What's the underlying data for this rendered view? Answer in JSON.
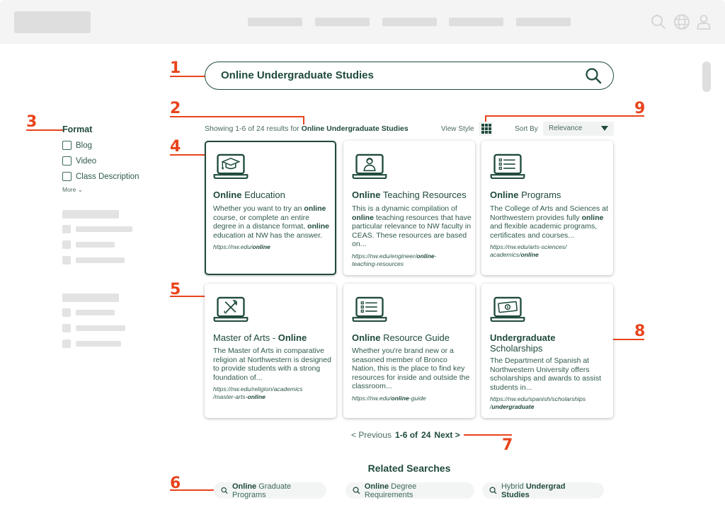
{
  "header": {
    "nav_placeholders": 5,
    "icons": [
      "search-icon",
      "globe-icon",
      "user-icon"
    ]
  },
  "search": {
    "query": "Online Undergraduate Studies",
    "icon": "search-icon"
  },
  "results": {
    "summary_prefix": "Showing 1-6 of 24 results for ",
    "summary_query": "Online Undergraduate Studies",
    "view_style_label": "View Style",
    "view_style_icon": "grid-icon",
    "sort_label": "Sort By",
    "sort_value": "Relevance"
  },
  "filters": {
    "title": "Format",
    "options": [
      {
        "label": "Blog",
        "checked": false
      },
      {
        "label": "Video",
        "checked": false
      },
      {
        "label": "Class Description",
        "checked": false
      }
    ],
    "more_label": "More"
  },
  "cards": [
    {
      "icon": "graduation-cap-laptop-icon",
      "title_bold": "Online",
      "title_rest": " Education",
      "body_html": "Whether you want to try an <b>online</b> course, or complete an entire degree in a distance format, <b>online</b> education at NW has the answer.",
      "url_html": "https://nw.edu/<b>online</b>",
      "selected": true
    },
    {
      "icon": "teacher-laptop-icon",
      "title_bold": "Online",
      "title_rest": " Teaching Resources",
      "body_html": "This is a dynamic compilation of <b>online</b> teaching resources that have particular relevance to NW faculty in CEAS. These resources are based on...",
      "url_html": "https://nw.edu/engineer/<b>online</b>-<br>teaching-resources",
      "selected": false
    },
    {
      "icon": "list-laptop-icon",
      "title_bold": "Online",
      "title_rest": " Programs",
      "body_html": "The College of Arts and Sciences at Northwestern provides fully <b>online</b> and flexible academic programs, certificates and courses...",
      "url_html": "https://nw.edu/arts-sciences/<br>academics/<b>online</b>",
      "selected": false
    },
    {
      "icon": "arts-laptop-icon",
      "title_html": "Master of Arts - <b>Online</b>",
      "body_html": "The Master of Arts in comparative religion at Northwestern is designed to provide students with a strong foundation of...",
      "url_html": "https://nw.edu/religion/academics<br>/master-arts-<b>online</b>",
      "selected": false
    },
    {
      "icon": "list-laptop-icon",
      "title_bold": "Online",
      "title_rest": " Resource Guide",
      "body_html": "Whether you're brand new or a seasoned member of Bronco Nation, this is the place to find key resources for inside and outside the classroom...",
      "url_html": "https://nw.edu/<b>online</b>-guide",
      "selected": false
    },
    {
      "icon": "money-laptop-icon",
      "title_html": "<b>Undergraduate</b><br>Scholarships",
      "body_html": "The Department of Spanish at Northwestern University offers scholarships and awards to assist students in...",
      "url_html": "https://nw.edu/spanish/scholarships<br>/<b>undergraduate</b>",
      "selected": false
    }
  ],
  "pagination": {
    "previous": "< Previous",
    "range": "1-6 of",
    "total": "24",
    "next": "Next >"
  },
  "related": {
    "title": "Related Searches",
    "items": [
      {
        "html": "<b>Online</b> Graduate Programs"
      },
      {
        "html": "<b>Online</b> Degree Requirements"
      },
      {
        "html": "Hybrid <b>Undergrad Studies</b>"
      }
    ]
  },
  "annotations": [
    "1",
    "2",
    "3",
    "4",
    "5",
    "6",
    "7",
    "8",
    "9"
  ],
  "colors": {
    "brand_green": "#1f4a3c",
    "annotation_orange": "#e8441c",
    "placeholder_gray": "#dedede"
  }
}
